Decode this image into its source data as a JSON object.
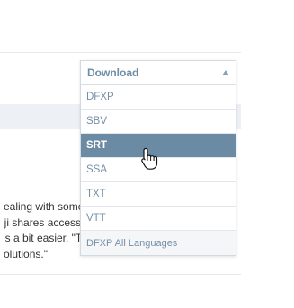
{
  "paragraph": {
    "line1": "ealing with some",
    "line2": "eji shares access",
    "line3": "t's a bit easier. \"Te",
    "line4": "olutions.\""
  },
  "dropdown": {
    "label": "Download",
    "items": [
      {
        "label": "DFXP"
      },
      {
        "label": "SBV"
      },
      {
        "label": "SRT",
        "selected": true
      },
      {
        "label": "SSA"
      },
      {
        "label": "TXT"
      },
      {
        "label": "VTT"
      },
      {
        "label": "DFXP All Languages"
      }
    ]
  },
  "colors": {
    "accent": "#6b8aa3",
    "item_text": "#7690a6",
    "header_text": "#6d8ea8"
  },
  "icons": {
    "caret": "caret-up-icon",
    "cursor": "hand-pointer-icon"
  }
}
